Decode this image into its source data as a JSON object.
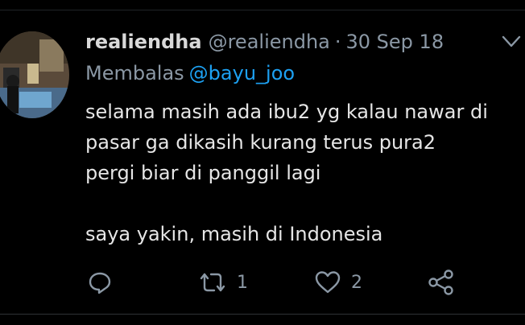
{
  "tweet": {
    "display_name": "realiendha",
    "handle": "@realiendha",
    "separator": "·",
    "date": "30 Sep 18",
    "reply_prefix": "Membalas",
    "reply_to": "@bayu_joo",
    "text_lines": [
      "selama masih ada ibu2 yg kalau nawar di",
      "pasar ga dikasih kurang terus pura2",
      "pergi biar di panggil lagi",
      "",
      "saya yakin, masih di Indonesia"
    ]
  },
  "actions": {
    "reply_icon": "reply-icon",
    "retweet_icon": "retweet-icon",
    "retweet_count": "1",
    "like_icon": "heart-icon",
    "like_count": "2",
    "share_icon": "share-icon"
  },
  "colors": {
    "background": "#000000",
    "text_primary": "#e6e6e6",
    "text_secondary": "#8b98a5",
    "link": "#1da1f2"
  }
}
